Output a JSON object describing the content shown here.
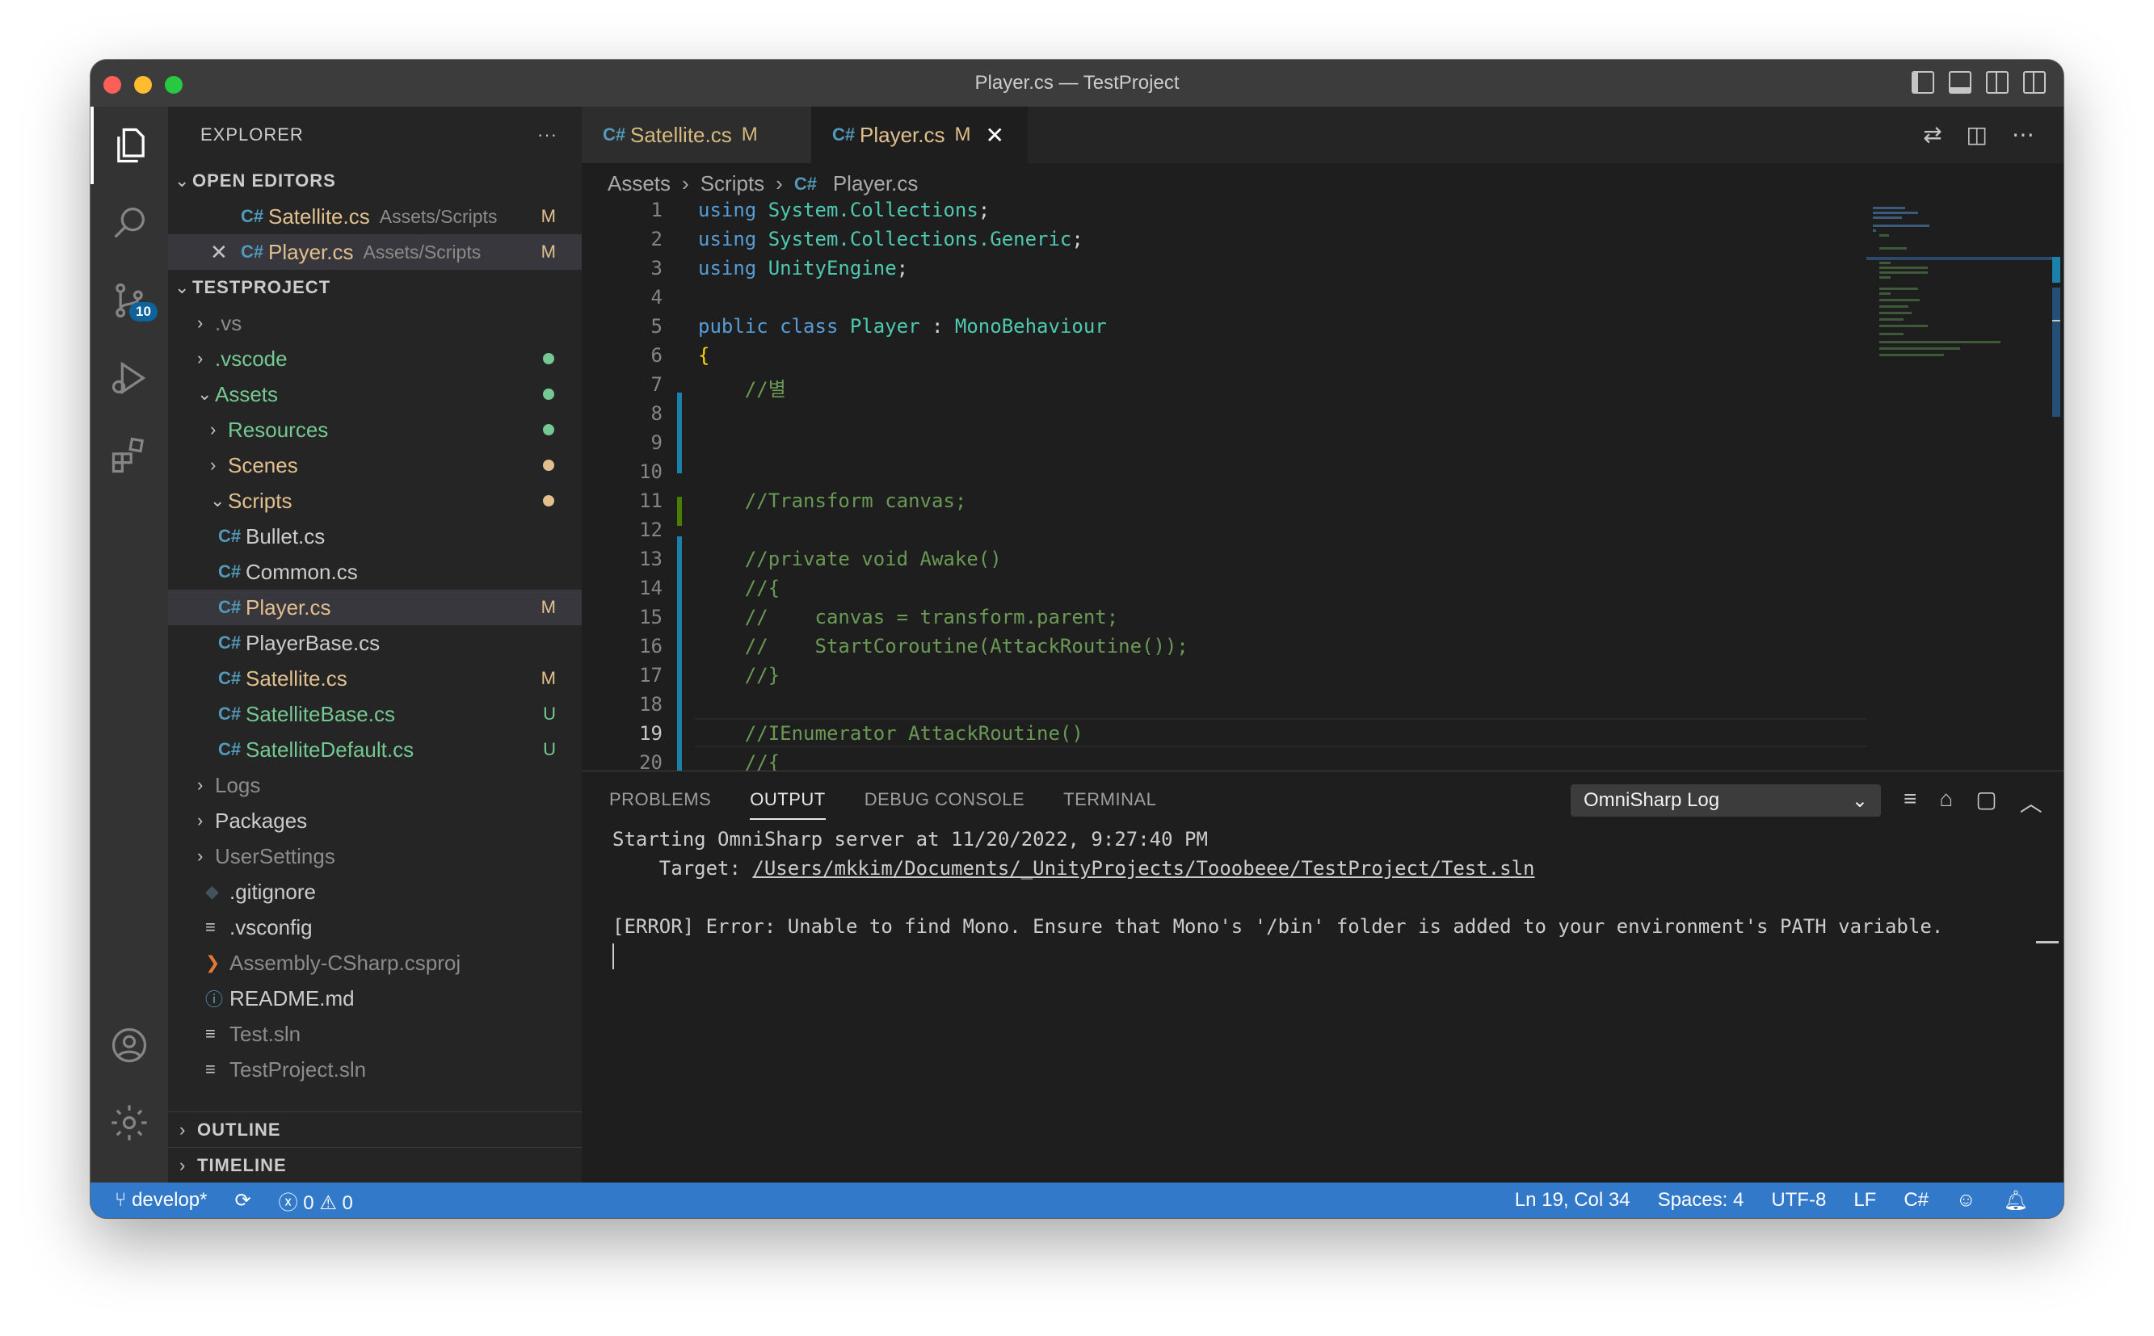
{
  "window": {
    "title": "Player.cs — TestProject"
  },
  "activity_bar": {
    "scm_badge": "10"
  },
  "sidebar": {
    "title": "EXPLORER",
    "more": "···",
    "open_editors": {
      "label": "OPEN EDITORS",
      "items": [
        {
          "name": "Satellite.cs",
          "path": "Assets/Scripts",
          "status": "M"
        },
        {
          "name": "Player.cs",
          "path": "Assets/Scripts",
          "status": "M",
          "close": "✕"
        }
      ]
    },
    "project": {
      "label": "TESTPROJECT",
      "items": [
        {
          "label": ".vs"
        },
        {
          "label": ".vscode"
        },
        {
          "label": "Assets"
        },
        {
          "label": "Resources"
        },
        {
          "label": "Scenes"
        },
        {
          "label": "Scripts"
        },
        {
          "label": "Bullet.cs"
        },
        {
          "label": "Common.cs"
        },
        {
          "label": "Player.cs",
          "status": "M"
        },
        {
          "label": "PlayerBase.cs"
        },
        {
          "label": "Satellite.cs",
          "status": "M"
        },
        {
          "label": "SatelliteBase.cs",
          "status": "U"
        },
        {
          "label": "SatelliteDefault.cs",
          "status": "U"
        },
        {
          "label": "Logs"
        },
        {
          "label": "Packages"
        },
        {
          "label": "UserSettings"
        },
        {
          "label": ".gitignore"
        },
        {
          "label": ".vsconfig"
        },
        {
          "label": "Assembly-CSharp.csproj"
        },
        {
          "label": "README.md"
        },
        {
          "label": "Test.sln"
        },
        {
          "label": "TestProject.sln"
        }
      ]
    },
    "outline": "OUTLINE",
    "timeline": "TIMELINE"
  },
  "editor": {
    "tabs": [
      {
        "label": "Satellite.cs",
        "status": "M"
      },
      {
        "label": "Player.cs",
        "status": "M",
        "close": "✕"
      }
    ],
    "breadcrumb": [
      "Assets",
      "Scripts",
      "Player.cs"
    ],
    "line_numbers": [
      "1",
      "2",
      "3",
      "4",
      "5",
      "6",
      "7",
      "8",
      "9",
      "10",
      "11",
      "12",
      "13",
      "14",
      "15",
      "16",
      "17",
      "18",
      "19",
      "20"
    ],
    "lines": {
      "l1a": "using ",
      "l1b": "System.Collections",
      "l1c": ";",
      "l2a": "using ",
      "l2b": "System.Collections.Generic",
      "l2c": ";",
      "l3a": "using ",
      "l3b": "UnityEngine",
      "l3c": ";",
      "l5a": "public class ",
      "l5b": "Player",
      "l5c": " : ",
      "l5d": "MonoBehaviour",
      "l6": "{",
      "l7": "    //별",
      "l11": "    //Transform canvas;",
      "l13": "    //private void Awake()",
      "l14": "    //{",
      "l15": "    //    canvas = transform.parent;",
      "l16": "    //    StartCoroutine(AttackRoutine());",
      "l17": "    //}",
      "l19": "    //IEnumerator AttackRoutine()",
      "l20": "    //{"
    }
  },
  "panel": {
    "tabs": [
      "PROBLEMS",
      "OUTPUT",
      "DEBUG CONSOLE",
      "TERMINAL"
    ],
    "active_tab": "OUTPUT",
    "channel": "OmniSharp Log",
    "output": {
      "line1": "Starting OmniSharp server at 11/20/2022, 9:27:40 PM",
      "line2_prefix": "    Target: ",
      "line2_link": "/Users/mkkim/Documents/_UnityProjects/Tooobeee/TestProject/Test.sln",
      "line3": "[ERROR] Error: Unable to find Mono. Ensure that Mono's '/bin' folder is added to your environment's PATH variable."
    }
  },
  "status_bar": {
    "branch": "develop*",
    "errors": "0",
    "warnings": "0",
    "cursor": "Ln 19, Col 34",
    "spaces": "Spaces: 4",
    "encoding": "UTF-8",
    "eol": "LF",
    "language": "C#"
  },
  "colors": {
    "accent": "#3379c9",
    "modified": "#e2c08d",
    "untracked": "#73c991",
    "csharp_icon": "#519aba"
  }
}
